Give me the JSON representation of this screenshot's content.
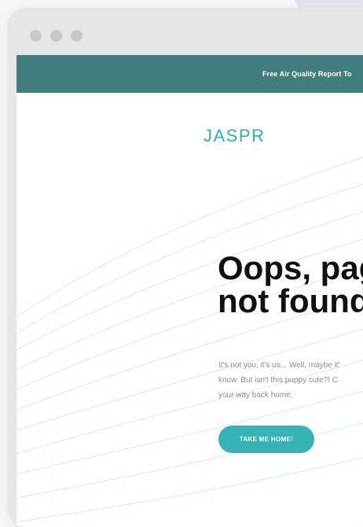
{
  "promo": {
    "text": "Free Air Quality Report To"
  },
  "brand": {
    "logo_text": "JASPR"
  },
  "main": {
    "headline_line1": "Oops, pag",
    "headline_line2": "not found",
    "body_line1": "It's not you, it's us... Well, maybe it'",
    "body_line2": "know. But isn't this puppy cute?! C",
    "body_line3": "your way back home.",
    "cta_label": "TAKE ME HOME!"
  },
  "colors": {
    "promo_bg": "#3f7e7b",
    "accent": "#36b3b7",
    "page_bg": "#ffffff"
  }
}
